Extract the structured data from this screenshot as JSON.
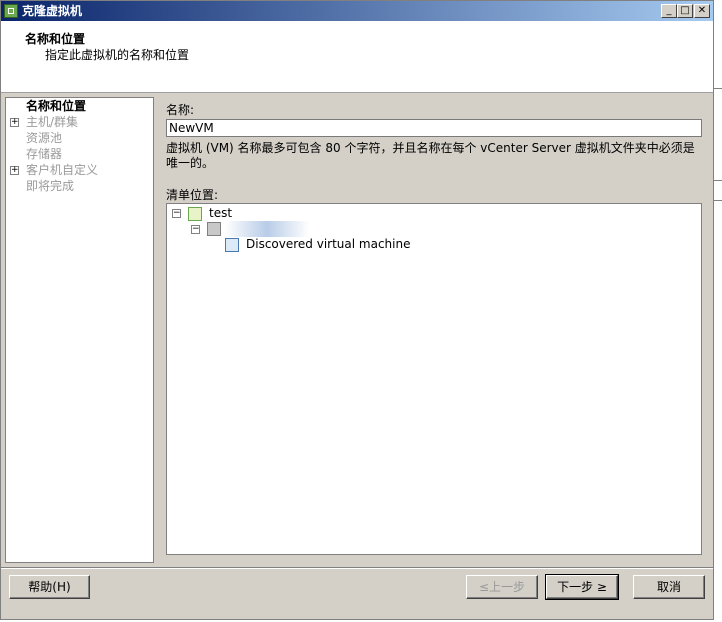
{
  "window": {
    "title": "克隆虚拟机",
    "icon": "vsphere-clone-icon",
    "controls": {
      "minimize": "_",
      "maximize": "□",
      "close": "✕"
    }
  },
  "header": {
    "title": "名称和位置",
    "subtitle": "指定此虚拟机的名称和位置"
  },
  "steps": [
    {
      "label": "名称和位置",
      "state": "active",
      "expandable": false
    },
    {
      "label": "主机/群集",
      "state": "disabled",
      "expandable": true
    },
    {
      "label": "资源池",
      "state": "disabled",
      "expandable": false
    },
    {
      "label": "存储器",
      "state": "disabled",
      "expandable": false
    },
    {
      "label": "客户机自定义",
      "state": "disabled",
      "expandable": true
    },
    {
      "label": "即将完成",
      "state": "disabled",
      "expandable": false
    }
  ],
  "form": {
    "name_label": "名称:",
    "name_value": "NewVM",
    "hint": "虚拟机 (VM) 名称最多可包含 80 个字符，并且名称在每个 vCenter Server 虚拟机文件夹中必须是唯一的。",
    "inventory_label": "清单位置:"
  },
  "tree": {
    "root": {
      "label": "test",
      "icon": "datacenter-icon",
      "expanded": true
    },
    "child": {
      "label": "",
      "icon": "host-cluster-icon",
      "expanded": true,
      "redacted": true
    },
    "leaf": {
      "label": "Discovered virtual machine",
      "icon": "vm-folder-icon"
    }
  },
  "buttons": {
    "help": "帮助(H)",
    "back": "≤上一步",
    "next": "下一步 ≥",
    "cancel": "取消"
  },
  "colors": {
    "title_bar_start": "#0a246a",
    "title_bar_end": "#a6caf0",
    "dialog_bg": "#d4d0c8",
    "disabled_text": "#9a9a9a"
  }
}
